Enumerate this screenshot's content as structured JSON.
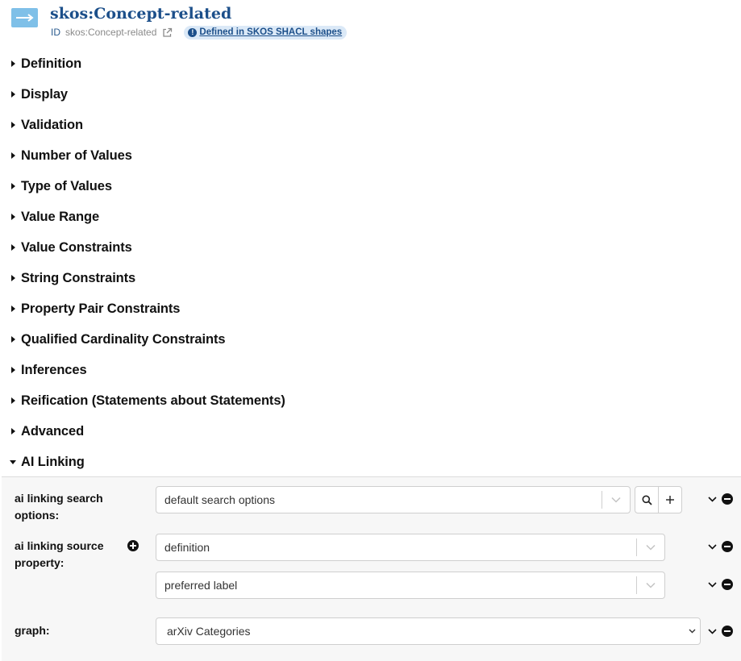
{
  "header": {
    "title": "skos:Concept-related",
    "id_label": "ID",
    "id_value": "skos:Concept-related",
    "badge_label": "Defined in SKOS SHACL shapes",
    "type_icon": "arrow-right-icon"
  },
  "sections": [
    {
      "label": "Definition",
      "expanded": false
    },
    {
      "label": "Display",
      "expanded": false
    },
    {
      "label": "Validation",
      "expanded": false
    },
    {
      "label": "Number of Values",
      "expanded": false
    },
    {
      "label": "Type of Values",
      "expanded": false
    },
    {
      "label": "Value Range",
      "expanded": false
    },
    {
      "label": "Value Constraints",
      "expanded": false
    },
    {
      "label": "String Constraints",
      "expanded": false
    },
    {
      "label": "Property Pair Constraints",
      "expanded": false
    },
    {
      "label": "Qualified Cardinality Constraints",
      "expanded": false
    },
    {
      "label": "Inferences",
      "expanded": false
    },
    {
      "label": "Reification (Statements about Statements)",
      "expanded": false
    },
    {
      "label": "Advanced",
      "expanded": false
    },
    {
      "label": "AI Linking",
      "expanded": true
    }
  ],
  "ai_linking": {
    "search_options": {
      "label": "ai linking search options:",
      "value": "default search options"
    },
    "source_property": {
      "label": "ai linking source property:",
      "values": [
        "definition",
        "preferred label"
      ]
    },
    "graph": {
      "label": "graph:",
      "value": "arXiv Categories"
    }
  },
  "colors": {
    "title": "#1c4f8a",
    "type_icon_bg": "#7fc0e8",
    "badge_bg": "#dbe9f7",
    "panel_bg": "#f7f7f7"
  }
}
